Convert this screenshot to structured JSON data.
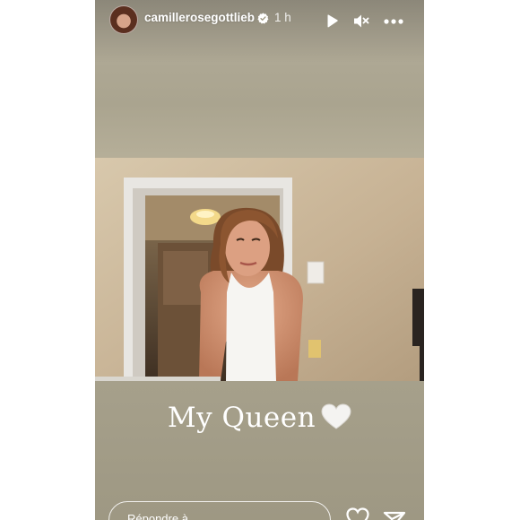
{
  "story": {
    "username": "camillerosegottlieb",
    "time": "1 h",
    "caption": "My Queen",
    "caption_emoji": "white-heart-emoji",
    "reply_placeholder": "Répondre à"
  },
  "icons": {
    "verified": "verified-badge-icon",
    "play": "play-icon",
    "mute": "muted-speaker-icon",
    "more": "more-dots-icon",
    "like": "heart-outline-icon",
    "send": "send-icon"
  },
  "colors": {
    "background": "#aaa48f",
    "text": "#ffffff",
    "verified": "#ffffff"
  }
}
